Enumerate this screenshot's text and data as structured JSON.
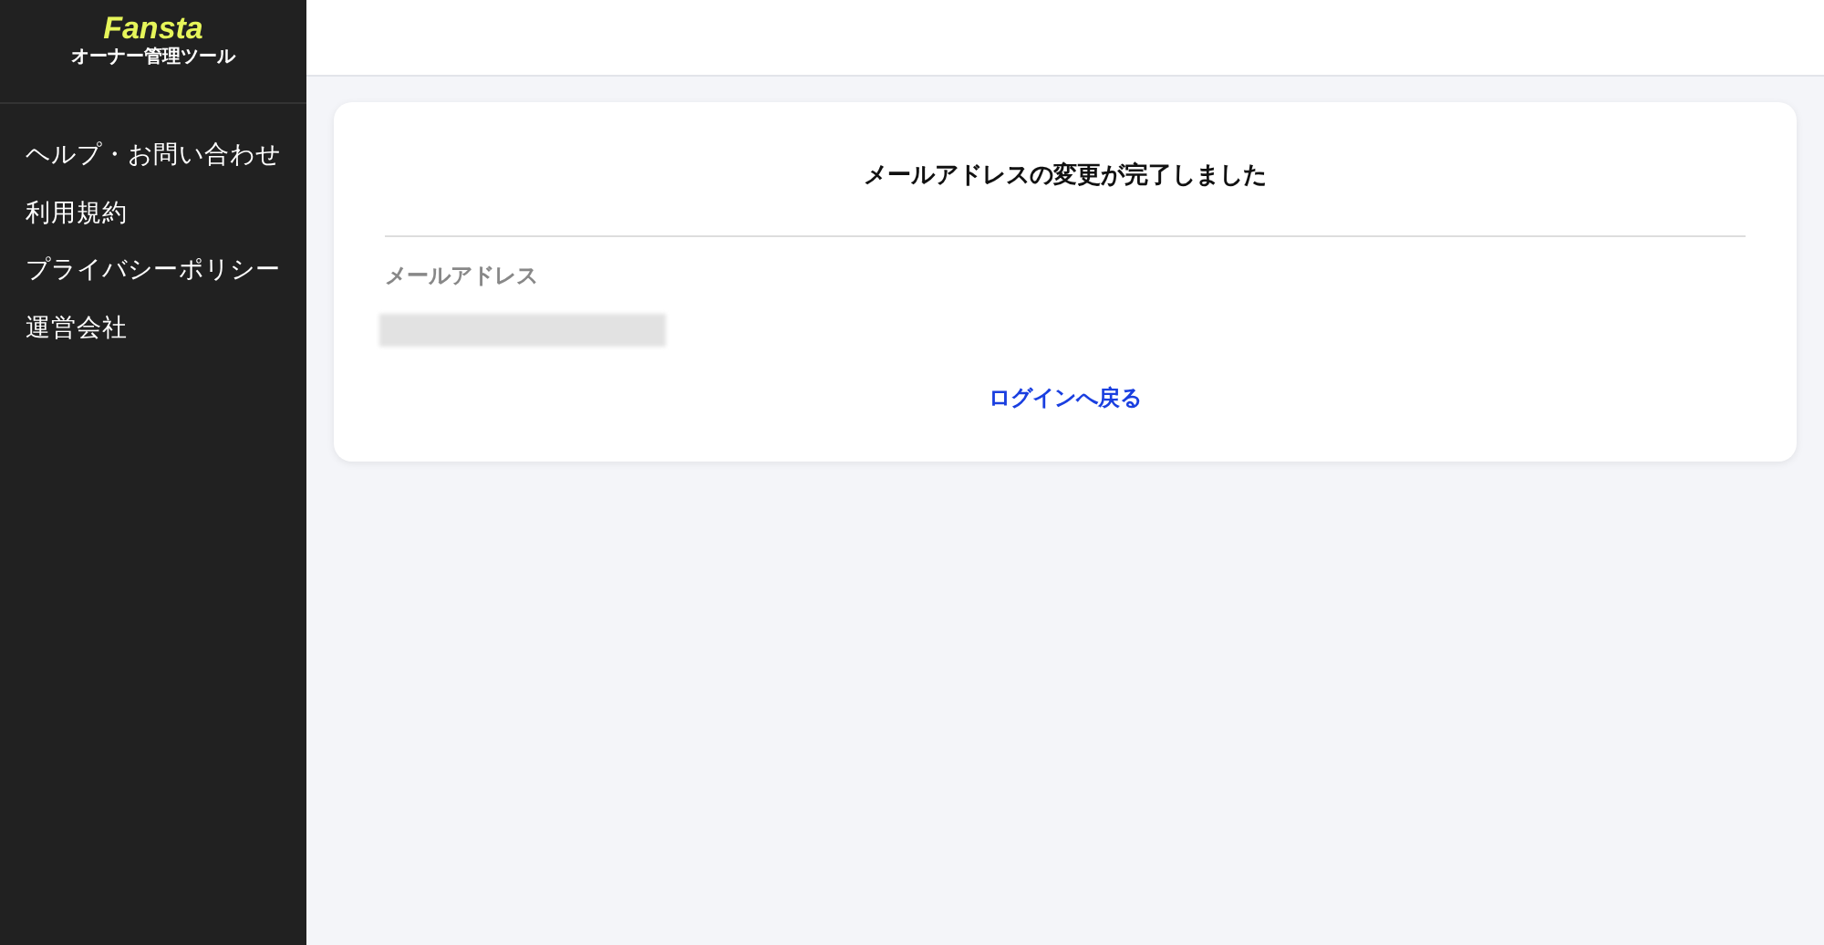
{
  "sidebar": {
    "logo": {
      "name": "Fansta",
      "subtitle": "オーナー管理ツール"
    },
    "items": [
      {
        "label": "ヘルプ・お問い合わせ"
      },
      {
        "label": "利用規約"
      },
      {
        "label": "プライバシーポリシー"
      },
      {
        "label": "運営会社"
      }
    ]
  },
  "card": {
    "title": "メールアドレスの変更が完了しました",
    "field_label": "メールアドレス",
    "field_value": {
      "kind": "redacted"
    },
    "link": "ログインへ戻る"
  }
}
